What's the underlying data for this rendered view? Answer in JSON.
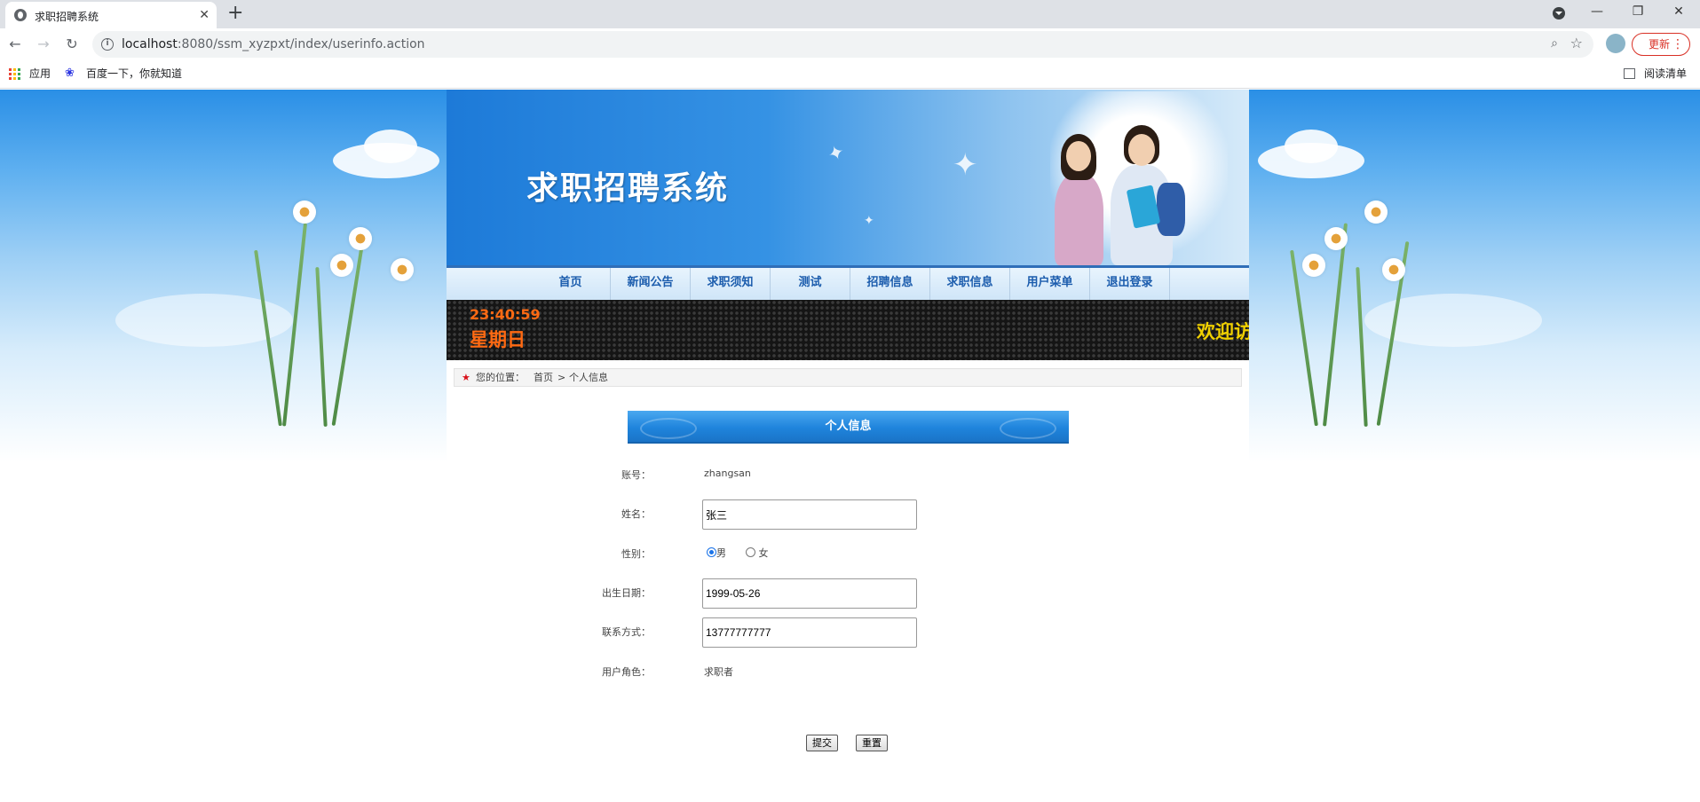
{
  "browser": {
    "tab_title": "求职招聘系统",
    "tab_close": "✕",
    "new_tab": "+",
    "url_host": "localhost",
    "url_path": ":8080/ssm_xyzpxt/index/userinfo.action",
    "update_label": "更新",
    "bookmarks": [
      {
        "label": "应用"
      },
      {
        "label": "百度一下，你就知道"
      }
    ],
    "reading_list": "阅读清单",
    "window_controls": {
      "minimize": "—",
      "restore": "❐",
      "close": "✕"
    }
  },
  "site": {
    "title": "求职招聘系统",
    "menu": [
      {
        "label": "首页"
      },
      {
        "label": "新闻公告"
      },
      {
        "label": "求职须知"
      },
      {
        "label": "测试"
      },
      {
        "label": "招聘信息"
      },
      {
        "label": "求职信息"
      },
      {
        "label": "用户菜单"
      },
      {
        "label": "退出登录"
      }
    ],
    "clock": "23:40:59",
    "weekday": "星期日",
    "marquee": "欢迎访"
  },
  "breadcrumb": {
    "label": "您的位置：",
    "home": "首页",
    "sep": ">",
    "current": "个人信息"
  },
  "form": {
    "heading": "个人信息",
    "account": {
      "label": "账号：",
      "value": "zhangsan"
    },
    "name": {
      "label": "姓名：",
      "value": "张三"
    },
    "gender": {
      "label": "性别：",
      "options": [
        "男",
        "女"
      ],
      "selected": "男"
    },
    "birthday": {
      "label": "出生日期：",
      "value": "1999-05-26"
    },
    "phone": {
      "label": "联系方式：",
      "value": "13777777777"
    },
    "role": {
      "label": "用户角色：",
      "value": "求职者"
    },
    "submit_label": "提交",
    "reset_label": "重置"
  },
  "colors": {
    "accent_blue": "#1f84dc",
    "menu_text": "#1b5cad",
    "led_orange": "#ff6a13",
    "led_yellow": "#f0d000",
    "update_red": "#d93025"
  }
}
